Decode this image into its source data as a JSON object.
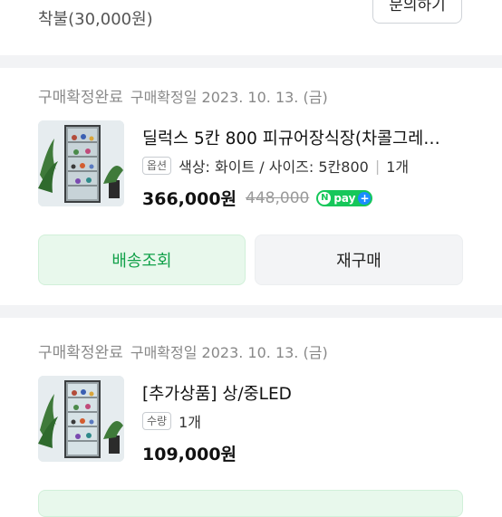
{
  "top": {
    "status_text": "착불(30,000원)",
    "inquiry_label": "문의하기"
  },
  "orders": [
    {
      "status": "구매확정완료",
      "date": "구매확정일 2023. 10. 13. (금)",
      "title": "딜럭스 5칸 800 피규어장식장(차콜그레…",
      "option_tag": "옵션",
      "option_text": "색상: 화이트 / 사이즈: 5칸800",
      "qty": "1개",
      "price": "366,000원",
      "orig_price": "448,000",
      "npay_label": "pay",
      "buttons": {
        "track": "배송조회",
        "rebuy": "재구매"
      }
    },
    {
      "status": "구매확정완료",
      "date": "구매확정일 2023. 10. 13. (금)",
      "title": "[추가상품] 상/중LED",
      "option_tag": "수량",
      "qty": "1개",
      "price": "109,000원"
    }
  ],
  "colors": {
    "green": "#12a14a",
    "green_bg": "#e8f8ec",
    "npay": "#16c75a"
  },
  "icons": [
    "npay-logo-icon",
    "plus-icon",
    "product-image-display-cabinet"
  ]
}
